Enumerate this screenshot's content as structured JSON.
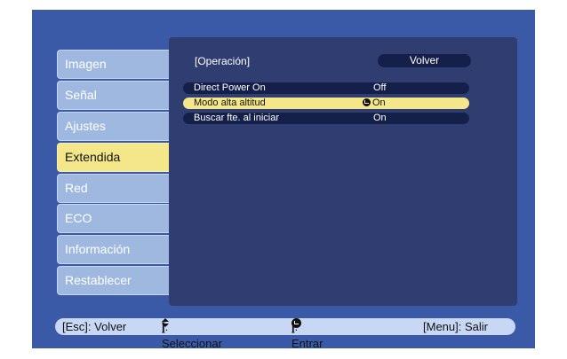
{
  "menu": {
    "items": [
      {
        "label": "Imagen",
        "active": false
      },
      {
        "label": "Señal",
        "active": false
      },
      {
        "label": "Ajustes",
        "active": false
      },
      {
        "label": "Extendida",
        "active": true
      },
      {
        "label": "Red",
        "active": false
      },
      {
        "label": "ECO",
        "active": false
      },
      {
        "label": "Información",
        "active": false
      },
      {
        "label": "Restablecer",
        "active": false
      }
    ]
  },
  "panel": {
    "section_title": "[Operación]",
    "back_label": "Volver",
    "rows": [
      {
        "label": "Direct Power On",
        "value": "Off",
        "selected": false
      },
      {
        "label": "Modo alta altitud",
        "value": "On",
        "selected": true
      },
      {
        "label": "Buscar fte. al iniciar",
        "value": "On",
        "selected": false
      }
    ]
  },
  "footer": {
    "esc": "[Esc]: Volver",
    "select_pre": "[",
    "select_post": "]: Seleccionar",
    "enter_pre": "[",
    "enter_post": "]: Entrar",
    "menu": "[Menu]: Salir"
  },
  "colors": {
    "screen_bg": "#3a5aa8",
    "panel_bg": "#2f3d70",
    "menu_item": "#9fb8e0",
    "highlight": "#f4e78a",
    "row_bg": "#15204a",
    "footer_bg": "#c8d7f3"
  }
}
